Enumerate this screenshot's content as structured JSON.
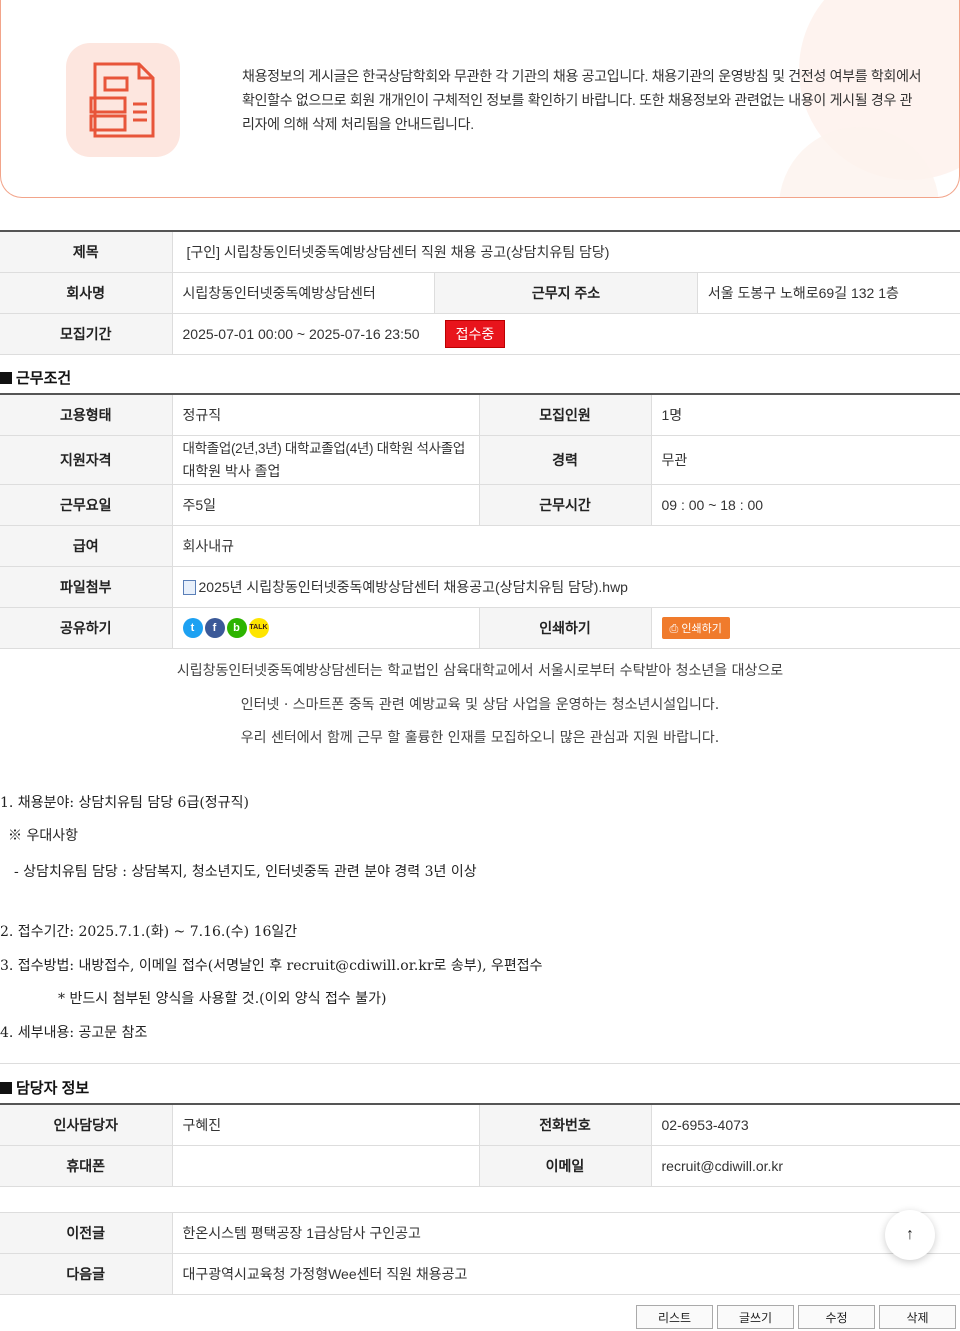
{
  "notice": {
    "text": "채용정보의 게시글은 한국상담학회와 무관한 각 기관의 채용 공고입니다. 채용기관의 운영방침 및 건전성 여부를 학회에서 확인할수 없으므로 회원 개개인이 구체적인 정보를 확인하기 바랍니다. 또한 채용정보와 관련없는 내용이 게시될 경우 관리자에 의해 삭제 처리됨을 안내드립니다."
  },
  "info": {
    "title_label": "제목",
    "title_value": "[구인] 시립창동인터넷중독예방상담센터 직원 채용 공고(상담치유팀 담당)",
    "company_label": "회사명",
    "company_value": "시립창동인터넷중독예방상담센터",
    "address_label": "근무지 주소",
    "address_value": "서울 도봉구 노해로69길 132 1층",
    "period_label": "모집기간",
    "period_value": "2025-07-01 00:00 ~ 2025-07-16 23:50",
    "status": "접수중"
  },
  "conditions": {
    "section_title": "근무조건",
    "employment_label": "고용형태",
    "employment_value": "정규직",
    "headcount_label": "모집인원",
    "headcount_value": "1명",
    "qualification_label": "지원자격",
    "qualification_line1": "대학졸업(2년,3년) 대학교졸업(4년) 대학원 석사졸업",
    "qualification_line2": "대학원 박사 졸업",
    "career_label": "경력",
    "career_value": "무관",
    "workdays_label": "근무요일",
    "workdays_value": "주5일",
    "hours_label": "근무시간",
    "hours_value": "09 : 00 ~ 18 : 00",
    "salary_label": "급여",
    "salary_value": "회사내규",
    "file_label": "파일첨부",
    "file_value": "2025년 시립창동인터넷중독예방상담센터 채용공고(상담치유팀 담당).hwp",
    "share_label": "공유하기",
    "print_label": "인쇄하기",
    "print_button": "인쇄하기",
    "share_icons": [
      "twitter-icon",
      "facebook-icon",
      "band-icon",
      "kakaotalk-icon"
    ]
  },
  "body": {
    "intro1": "시립창동인터넷중독예방상담센터는 학교법인 삼육대학교에서 서울시로부터 수탁받아 청소년을 대상으로",
    "intro2": "인터넷 · 스마트폰 중독 관련 예방교육 및 상담 사업을 운영하는 청소년시설입니다.",
    "intro3": "우리 센터에서 함께 근무 할 훌륭한 인재를 모집하오니 많은 관심과 지원 바랍니다.",
    "item1": "1. 채용분야: 상담치유팀 담당 6급(정규직)",
    "item1_note": "※  우대사항",
    "item1_sub": "- 상담치유팀 담당 : 상담복지, 청소년지도, 인터넷중독 관련 분야 경력 3년 이상",
    "item2": "2. 접수기간: 2025.7.1.(화) ~ 7.16.(수) 16일간",
    "item3": "3. 접수방법: 내방접수, 이메일 접수(서명날인 후 recruit@cdiwill.or.kr로 송부), 우편접수",
    "item3_note": "* 반드시 첨부된 양식을 사용할 것.(이외 양식 접수 불가)",
    "item4": "4. 세부내용: 공고문 참조"
  },
  "contact": {
    "section_title": "담당자 정보",
    "manager_label": "인사담당자",
    "manager_value": "구혜진",
    "phone_label": "전화번호",
    "phone_value": "02-6953-4073",
    "mobile_label": "휴대폰",
    "mobile_value": "",
    "email_label": "이메일",
    "email_value": "recruit@cdiwill.or.kr"
  },
  "nav": {
    "prev_label": "이전글",
    "prev_value": "한온시스템 평택공장 1급상담사 구인공고",
    "next_label": "다음글",
    "next_value": "대구광역시교육청 가정형Wee센터 직원 채용공고"
  },
  "buttons": {
    "list": "리스트",
    "write": "글쓰기",
    "edit": "수정",
    "delete": "삭제"
  },
  "colors": {
    "accent": "#f07b2c",
    "status_red": "#e8141c",
    "notice_border": "#f2a48a"
  }
}
